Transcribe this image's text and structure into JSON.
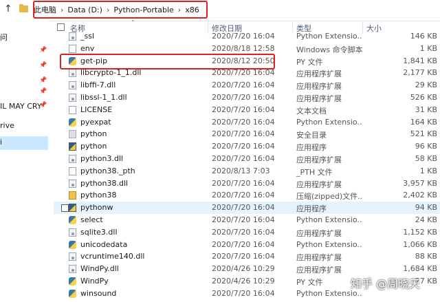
{
  "address": {
    "crumbs": [
      "此电脑",
      "Data (D:)",
      "Python-Portable",
      "x86"
    ],
    "separator": "›"
  },
  "sidebar": {
    "items": [
      {
        "label": "问",
        "pinned": false,
        "selected": false
      },
      {
        "label": "",
        "pinned": true,
        "selected": false
      },
      {
        "label": "",
        "pinned": true,
        "selected": false
      },
      {
        "label": "",
        "pinned": true,
        "selected": false
      },
      {
        "label": "",
        "pinned": true,
        "selected": false
      },
      {
        "label": "IL MAY CRY",
        "pinned": true,
        "selected": false
      },
      {
        "label": "rive",
        "pinned": false,
        "selected": false
      },
      {
        "label": "i",
        "pinned": false,
        "selected": true
      }
    ]
  },
  "columns": {
    "name": "名称",
    "date": "修改日期",
    "type": "类型",
    "size": "大小"
  },
  "files": [
    {
      "name": "_ssl",
      "date": "2020/7/20 16:04",
      "type": "Python Extensio...",
      "size": "146 KB",
      "icon": "dll-icon"
    },
    {
      "name": "env",
      "date": "2020/8/18 12:58",
      "type": "Windows 命令脚本",
      "size": "1 KB",
      "icon": "document-icon"
    },
    {
      "name": "get-pip",
      "date": "2020/8/12 20:50",
      "type": "PY 文件",
      "size": "1,841 KB",
      "icon": "python-file-icon"
    },
    {
      "name": "libcrypto-1_1.dll",
      "date": "2020/7/20 16:04",
      "type": "应用程序扩展",
      "size": "2,177 KB",
      "icon": "dll-icon"
    },
    {
      "name": "libffi-7.dll",
      "date": "2020/7/20 16:04",
      "type": "应用程序扩展",
      "size": "29 KB",
      "icon": "dll-icon"
    },
    {
      "name": "libssl-1_1.dll",
      "date": "2020/7/20 16:04",
      "type": "应用程序扩展",
      "size": "526 KB",
      "icon": "dll-icon"
    },
    {
      "name": "LICENSE",
      "date": "2020/7/20 16:04",
      "type": "文本文档",
      "size": "31 KB",
      "icon": "document-icon"
    },
    {
      "name": "pyexpat",
      "date": "2020/7/20 16:04",
      "type": "Python Extensio...",
      "size": "164 KB",
      "icon": "python-file-icon"
    },
    {
      "name": "python",
      "date": "2020/7/20 16:04",
      "type": "安全目录",
      "size": "521 KB",
      "icon": "catalog-icon"
    },
    {
      "name": "python",
      "date": "2020/7/20 16:04",
      "type": "应用程序",
      "size": "96 KB",
      "icon": "python-app-icon"
    },
    {
      "name": "python3.dll",
      "date": "2020/7/20 16:04",
      "type": "应用程序扩展",
      "size": "58 KB",
      "icon": "dll-icon"
    },
    {
      "name": "python38._pth",
      "date": "2020/8/13 7:03",
      "type": "_PTH 文件",
      "size": "1 KB",
      "icon": "document-icon"
    },
    {
      "name": "python38.dll",
      "date": "2020/7/20 16:04",
      "type": "应用程序扩展",
      "size": "3,957 KB",
      "icon": "dll-icon"
    },
    {
      "name": "python38",
      "date": "2020/7/20 16:04",
      "type": "压缩(zipped)文件...",
      "size": "2,402 KB",
      "icon": "zip-icon"
    },
    {
      "name": "pythonw",
      "date": "2020/7/20 16:04",
      "type": "应用程序",
      "size": "94 KB",
      "icon": "python-app-icon",
      "selected": true
    },
    {
      "name": "select",
      "date": "2020/7/20 16:04",
      "type": "Python Extensio...",
      "size": "24 KB",
      "icon": "python-file-icon"
    },
    {
      "name": "sqlite3.dll",
      "date": "2020/7/20 16:04",
      "type": "应用程序扩展",
      "size": "1,152 KB",
      "icon": "dll-icon"
    },
    {
      "name": "unicodedata",
      "date": "2020/7/20 16:04",
      "type": "Python Extensio...",
      "size": "1,066 KB",
      "icon": "python-file-icon"
    },
    {
      "name": "vcruntime140.dll",
      "date": "2020/7/20 16:04",
      "type": "应用程序扩展",
      "size": "88 KB",
      "icon": "dll-icon"
    },
    {
      "name": "WindPy.dll",
      "date": "2020/4/26 10:29",
      "type": "应用程序扩展",
      "size": "1,684 KB",
      "icon": "dll-icon"
    },
    {
      "name": "WindPy",
      "date": "2020/4/26 10:29",
      "type": "PY 文件",
      "size": "27 KB",
      "icon": "python-file-icon"
    },
    {
      "name": "winsound",
      "date": "2020/7/20 16:04",
      "type": "Python Extensio...",
      "size": "",
      "icon": "python-file-icon"
    }
  ],
  "watermark": "知乎 @周晓天",
  "colors": {
    "highlight_box": "#e02020",
    "selected_row": "#e5f3ff",
    "sidebar_selected": "#cce8ff",
    "header_text": "#4c607a"
  }
}
